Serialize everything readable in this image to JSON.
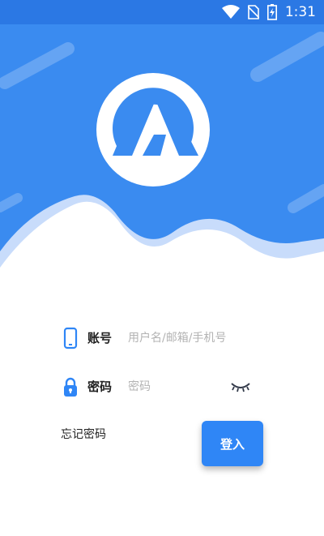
{
  "status_bar": {
    "time": "1:31",
    "icons": [
      "wifi-icon",
      "no-sim-icon",
      "battery-charging-icon"
    ]
  },
  "brand": {
    "logo": "logo-icon"
  },
  "form": {
    "account": {
      "label": "账号",
      "placeholder": "用户名/邮箱/手机号",
      "icon": "phone-icon"
    },
    "password": {
      "label": "密码",
      "placeholder": "密码",
      "icon": "lock-icon",
      "toggle_icon": "eye-closed-icon"
    },
    "forgot_label": "忘记密码",
    "login_label": "登入"
  },
  "colors": {
    "primary": "#2f86f6",
    "status_bar": "#2b78e4",
    "hero_blue": "#3a8bf0",
    "wave_light": "#c8dcfb"
  }
}
